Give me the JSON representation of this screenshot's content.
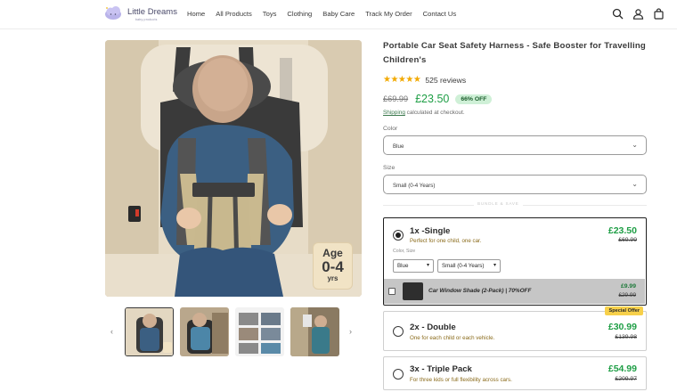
{
  "header": {
    "logo_text": "Little Dreams",
    "logo_sub": "baby products",
    "nav": [
      "Home",
      "All Products",
      "Toys",
      "Clothing",
      "Baby Care",
      "Track My Order",
      "Contact Us"
    ],
    "icons": [
      "search-icon",
      "user-icon",
      "cart-icon"
    ]
  },
  "gallery": {
    "age_badge": {
      "line1": "Age",
      "line2": "0-4",
      "line3": "yrs"
    },
    "prev_arrow": "‹",
    "next_arrow": "›",
    "thumbnail_count": 4
  },
  "product": {
    "title": "Portable Car Seat Safety Harness - Safe Booster for Travelling Children's",
    "stars": "★★★★★",
    "reviews": "525 reviews",
    "old_price": "£69.99",
    "new_price": "£23.50",
    "off_badge": "66% OFF",
    "shipping_link": "Shipping",
    "shipping_text": " calculated at checkout.",
    "color_label": "Color",
    "color_value": "Blue",
    "size_label": "Size",
    "size_value": "Small (0-4 Years)",
    "divider_text": "BUNDLE & SAVE"
  },
  "bundles": [
    {
      "title": "1x -Single",
      "subtitle": "Perfect for one child, one car.",
      "price": "£23.50",
      "old_price": "£69.99",
      "selected": true,
      "options_label": "Color, Size",
      "color": "Blue",
      "size": "Small (0-4 Years)",
      "upsell": {
        "title": "Car Window Shade (2-Pack) | 70%OFF",
        "price": "£9.99",
        "old_price": "£29.99"
      }
    },
    {
      "title": "2x - Double",
      "subtitle": "One for each child or each vehicle.",
      "price": "£30.99",
      "old_price": "£139.98",
      "badge": "Special Offer",
      "selected": false
    },
    {
      "title": "3x - Triple Pack",
      "subtitle": "For three kids or full flexibility across cars.",
      "price": "£54.99",
      "old_price": "£209.97",
      "selected": false
    }
  ],
  "colors": {
    "accent_green": "#1e9e45",
    "star": "#f2a900",
    "badge_bg": "#cff0d7",
    "special_bg": "#f7d04a"
  }
}
